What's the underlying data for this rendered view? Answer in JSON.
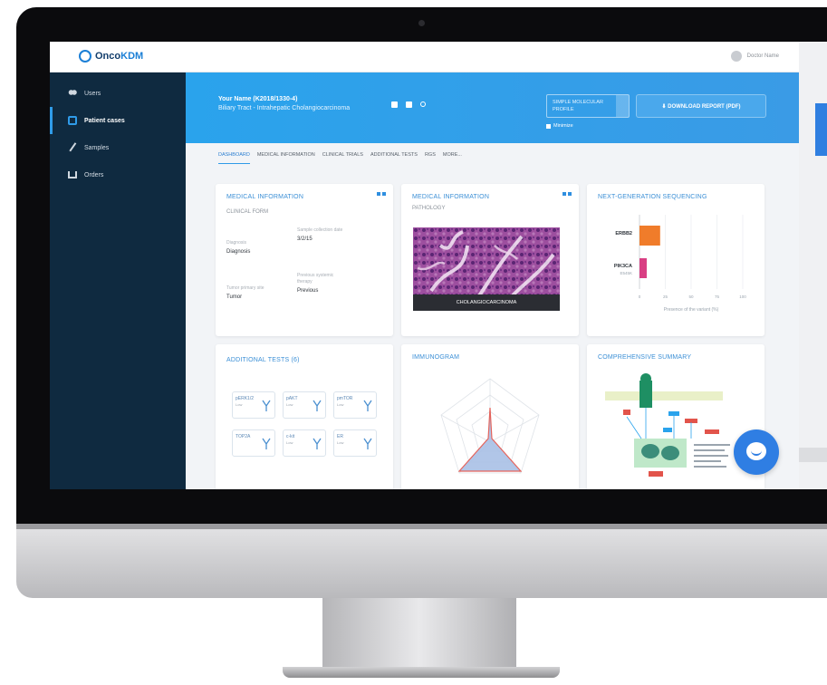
{
  "app": {
    "brand_prefix": "Onco",
    "brand_suffix": "KDM"
  },
  "topbar": {
    "user_name": "Doctor Name"
  },
  "sidebar": {
    "items": [
      {
        "label": "Users",
        "icon": "users-icon"
      },
      {
        "label": "Patient cases",
        "icon": "folder-icon"
      },
      {
        "label": "Samples",
        "icon": "pipette-icon"
      },
      {
        "label": "Orders",
        "icon": "cart-icon"
      }
    ]
  },
  "header": {
    "case_title": "Your Name (K2018/1330-4)",
    "case_subtitle": "Biliary Tract - Intrahepatic Cholangiocarcinoma",
    "select_value": "SIMPLE MOLECULAR PROFILE",
    "checkbox_label": "Minimize",
    "download_label": "⬇ DOWNLOAD REPORT (PDF)"
  },
  "tabs": [
    "DASHBOARD",
    "MEDICAL INFORMATION",
    "CLINICAL TRIALS",
    "ADDITIONAL TESTS",
    "RGS",
    "MORE..."
  ],
  "cards": {
    "medical_info": {
      "title": "MEDICAL INFORMATION",
      "subtitle": "CLINICAL FORM",
      "fields": [
        {
          "label": "Diagnosis",
          "value": "Diagnosis"
        },
        {
          "label": "Sample collection date",
          "value": "3/2/15"
        },
        {
          "label": "Tumor primary site",
          "value": "Tumor"
        },
        {
          "label": "Previous systemic therapy",
          "value": "Previous"
        }
      ]
    },
    "pathology": {
      "title": "MEDICAL INFORMATION",
      "subtitle": "PATHOLOGY",
      "caption": "CHOLANGIOCARCINOMA"
    },
    "ngs": {
      "title": "NEXT-GENERATION SEQUENCING",
      "genes": [
        {
          "gene": "ERBB2",
          "detail": "",
          "color": "#f07c2a"
        },
        {
          "gene": "PIK3CA",
          "detail": "E545K",
          "color": "#d93f83"
        }
      ],
      "x_ticks": [
        "0",
        "25",
        "50",
        "75",
        "100"
      ],
      "x_label": "Presence of the variant (%)"
    },
    "additional_tests": {
      "title": "ADDITIONAL TESTS (6)",
      "tests": [
        {
          "name": "pERK1/2",
          "sub": "Low"
        },
        {
          "name": "pAKT",
          "sub": "Low"
        },
        {
          "name": "pmTOR",
          "sub": "Low"
        },
        {
          "name": "TOP2A",
          "sub": ""
        },
        {
          "name": "c-kit",
          "sub": "Low"
        },
        {
          "name": "ER",
          "sub": "Low"
        }
      ]
    },
    "immunogram": {
      "title": "IMMUNOGRAM"
    },
    "summary": {
      "title": "COMPREHENSIVE SUMMARY"
    }
  },
  "chart_data": {
    "type": "bar",
    "categories": [
      "ERBB2",
      "PIK3CA"
    ],
    "values": [
      20,
      7
    ],
    "xlabel": "Presence of the variant (%)",
    "xlim": [
      0,
      100
    ],
    "orientation": "horizontal"
  }
}
